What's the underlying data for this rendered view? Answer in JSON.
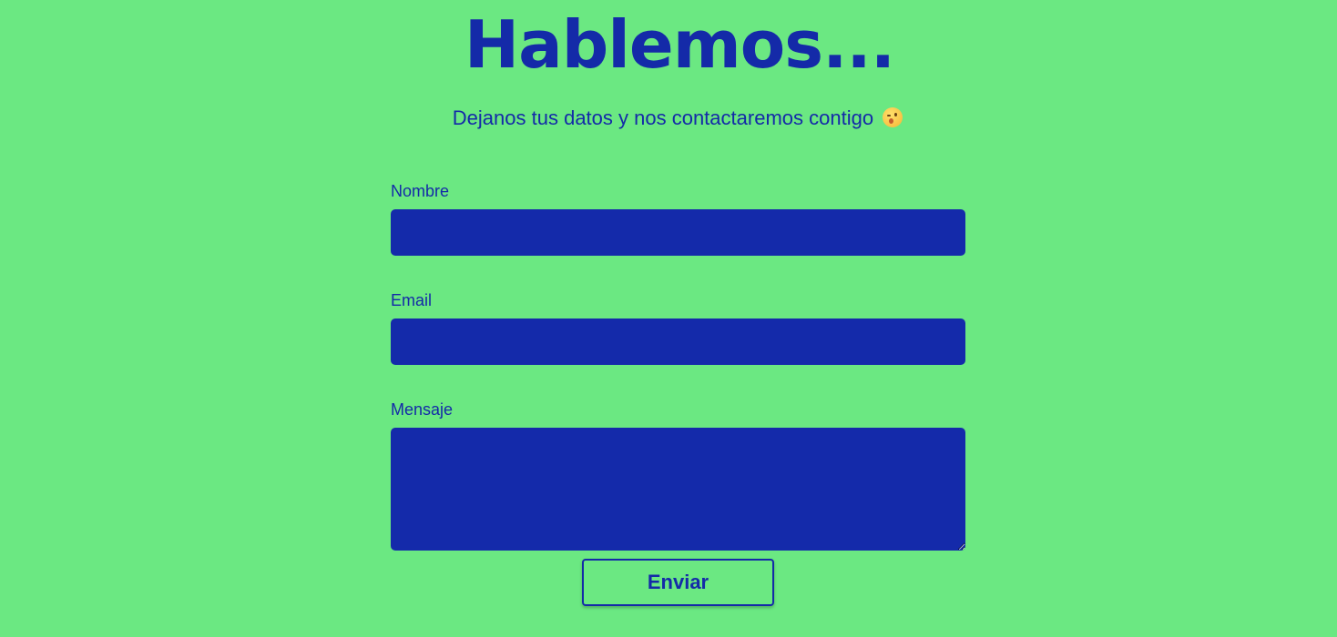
{
  "header": {
    "title": "Hablemos...",
    "subtitle": "Dejanos tus datos y nos contactaremos contigo",
    "subtitle_emoji_icon": "winking-face-icon"
  },
  "form": {
    "name_label": "Nombre",
    "name_value": "",
    "email_label": "Email",
    "email_value": "",
    "message_label": "Mensaje",
    "message_value": "",
    "submit_label": "Enviar"
  },
  "colors": {
    "background": "#6be882",
    "primary": "#142aa8"
  }
}
